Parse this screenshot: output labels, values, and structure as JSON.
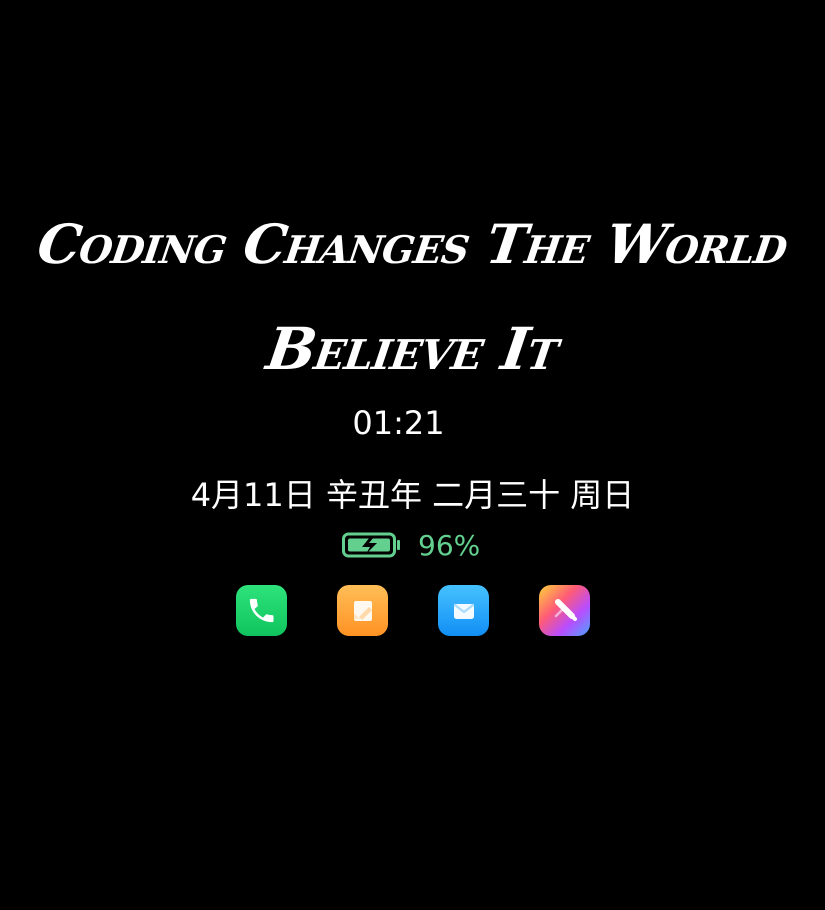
{
  "lockscreen": {
    "quote_line_1": "Coding Changes The World",
    "quote_line_2": "Believe It",
    "time": "01:21",
    "date": "4月11日 辛丑年 二月三十  周日",
    "battery": {
      "percent": "96%",
      "charging": true,
      "level": 0.96,
      "color": "#63d08f",
      "icon": "battery-charging-icon"
    },
    "apps": [
      {
        "icon": "phone-icon",
        "color": "#18cc67"
      },
      {
        "icon": "notes-icon",
        "color": "#ffa33a"
      },
      {
        "icon": "mail-icon",
        "color": "#249ffb"
      },
      {
        "icon": "theme-store-icon",
        "color": "#ff5b76"
      }
    ]
  }
}
